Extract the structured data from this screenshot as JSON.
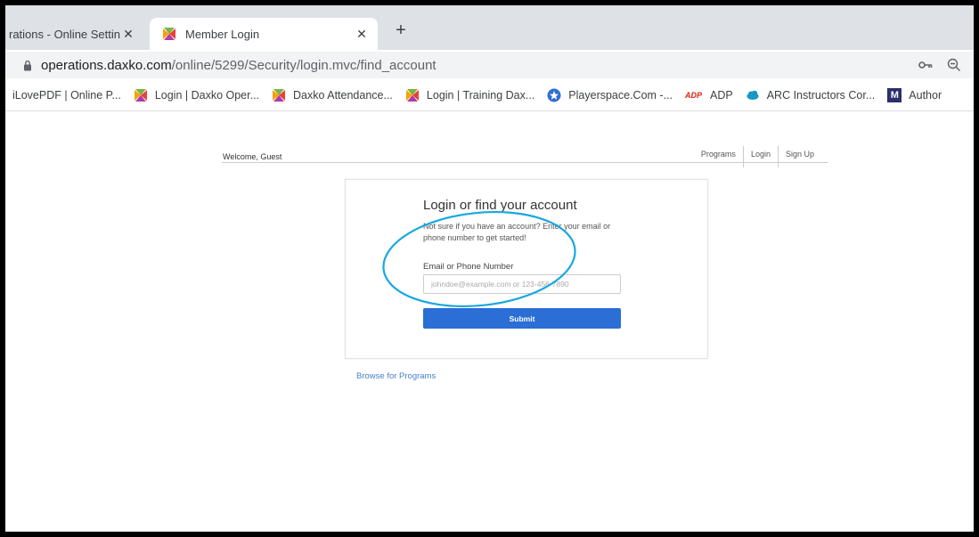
{
  "browser": {
    "tabs": [
      {
        "title": "rations - Online Settin",
        "close": "✕"
      },
      {
        "title": "Member Login",
        "close": "✕"
      }
    ],
    "new_tab": "+",
    "url_host": "operations.daxko.com",
    "url_path": "/online/5299/Security/login.mvc/find_account",
    "bookmarks": [
      {
        "label": "iLovePDF | Online P...",
        "icon": "none"
      },
      {
        "label": "Login | Daxko Oper...",
        "icon": "daxko-icon"
      },
      {
        "label": "Daxko Attendance...",
        "icon": "daxko-icon"
      },
      {
        "label": "Login | Training Dax...",
        "icon": "daxko-icon"
      },
      {
        "label": "Playerspace.Com -...",
        "icon": "playerspace-icon"
      },
      {
        "label": "ADP",
        "icon": "adp-icon"
      },
      {
        "label": "ARC Instructors Cor...",
        "icon": "salesforce-cloud-icon"
      },
      {
        "label": "Author",
        "icon": "m-icon"
      }
    ],
    "m_icon_letter": "M",
    "adp_icon_text": "ADP"
  },
  "page": {
    "welcome": "Welcome, Guest",
    "nav": [
      "Programs",
      "Login",
      "Sign Up"
    ],
    "card": {
      "title": "Login or find your account",
      "description": "Not sure if you have an account? Enter your email or phone number to get started!",
      "field_label": "Email or Phone Number",
      "field_placeholder": "johndoe@example.com or 123-456-7890",
      "submit_label": "Submit"
    },
    "browse_link": "Browse for Programs"
  },
  "colors": {
    "accent_button": "#2a6ed6",
    "annotation_circle": "#1aa7df",
    "link": "#4a7fc8"
  }
}
